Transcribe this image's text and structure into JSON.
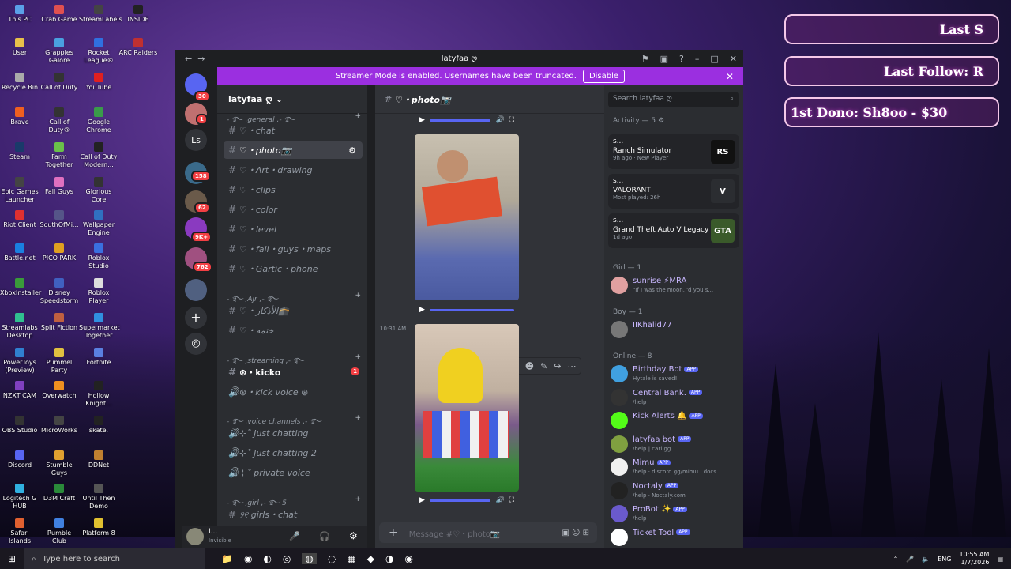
{
  "desktop": {
    "icons": [
      {
        "label": "This PC",
        "color": "#5aa0e8"
      },
      {
        "label": "Crab Game",
        "color": "#e05050"
      },
      {
        "label": "StreamLabels",
        "color": "#444"
      },
      {
        "label": "INSIDE",
        "color": "#222"
      },
      {
        "label": "User",
        "color": "#e8c04a"
      },
      {
        "label": "Grapples Galore",
        "color": "#4aa0e0"
      },
      {
        "label": "Rocket League®",
        "color": "#3070e0"
      },
      {
        "label": "ARC Raiders",
        "color": "#c03030"
      },
      {
        "label": "Recycle Bin",
        "color": "#aaa"
      },
      {
        "label": "Call of Duty",
        "color": "#333"
      },
      {
        "label": "YouTube",
        "color": "#e02020"
      },
      {
        "label": "Brave",
        "color": "#f06020"
      },
      {
        "label": "Call of Duty®",
        "color": "#333"
      },
      {
        "label": "Google Chrome",
        "color": "#3a9a4a"
      },
      {
        "label": "Steam",
        "color": "#1a3a6a"
      },
      {
        "label": "Farm Together",
        "color": "#6ac04a"
      },
      {
        "label": "Call of Duty Modern...",
        "color": "#222"
      },
      {
        "label": "Epic Games Launcher",
        "color": "#444"
      },
      {
        "label": "Fall Guys",
        "color": "#e070c0"
      },
      {
        "label": "Glorious Core",
        "color": "#333"
      },
      {
        "label": "Riot Client",
        "color": "#e03030"
      },
      {
        "label": "SouthOfMi...",
        "color": "#558"
      },
      {
        "label": "Wallpaper Engine",
        "color": "#3070c0"
      },
      {
        "label": "Battle.net",
        "color": "#1a80e0"
      },
      {
        "label": "PICO PARK",
        "color": "#e0a020"
      },
      {
        "label": "Roblox Studio",
        "color": "#3a70e0"
      },
      {
        "label": "XboxInstaller",
        "color": "#3a9a3a"
      },
      {
        "label": "Disney Speedstorm",
        "color": "#4060c0"
      },
      {
        "label": "Roblox Player",
        "color": "#ddd"
      },
      {
        "label": "Streamlabs Desktop",
        "color": "#30c090"
      },
      {
        "label": "Split Fiction",
        "color": "#c06040"
      },
      {
        "label": "Supermarket Together",
        "color": "#3090e0"
      },
      {
        "label": "PowerToys (Preview)",
        "color": "#3080d0"
      },
      {
        "label": "Pummel Party",
        "color": "#e0c040"
      },
      {
        "label": "Fortnite",
        "color": "#5a80e0"
      },
      {
        "label": "NZXT CAM",
        "color": "#8040c0"
      },
      {
        "label": "Overwatch",
        "color": "#f09020"
      },
      {
        "label": "Hollow Knight...",
        "color": "#222"
      },
      {
        "label": "OBS Studio",
        "color": "#333"
      },
      {
        "label": "MicroWorks",
        "color": "#444"
      },
      {
        "label": "skate.",
        "color": "#222"
      },
      {
        "label": "Discord",
        "color": "#5865f2"
      },
      {
        "label": "Stumble Guys",
        "color": "#e0a030"
      },
      {
        "label": "DDNet",
        "color": "#c08030"
      },
      {
        "label": "Logitech G HUB",
        "color": "#30b0e0"
      },
      {
        "label": "D3M Craft",
        "color": "#2a8a3a"
      },
      {
        "label": "Until Then Demo",
        "color": "#555"
      },
      {
        "label": "Safari Islands",
        "color": "#e06030"
      },
      {
        "label": "Rumble Club",
        "color": "#4080e0"
      },
      {
        "label": "Platform 8",
        "color": "#e0c030"
      }
    ]
  },
  "overlay": {
    "last_sub": "Last S",
    "last_follow": "Last Follow: R",
    "donation": "1st Dono: Sh8oo - $30"
  },
  "window": {
    "title": "latyfaa ღ"
  },
  "streamer": {
    "text": "Streamer Mode is enabled. Usernames have been truncated.",
    "button": "Disable"
  },
  "guilds": {
    "badges": [
      "30",
      "1",
      "158",
      "62",
      "9K+",
      "762"
    ],
    "dm_label": "Ls"
  },
  "server": {
    "name": "latyfaa ღ",
    "categories": [
      {
        "label": "- ࿐ ,general ,- ࿐"
      },
      {
        "label": "- ࿐ ,Ajr ,- ࿐"
      },
      {
        "label": "- ࿐ ,streaming ,- ࿐"
      },
      {
        "label": "- ࿐ ,voice channels ,- ࿐"
      },
      {
        "label": "- ࿐ ,girl ,- ࿐ 5"
      }
    ],
    "channels": [
      {
        "label": "♡・chat"
      },
      {
        "label": "♡・photo📷"
      },
      {
        "label": "♡・Art・drawing"
      },
      {
        "label": "♡・clips"
      },
      {
        "label": "♡・color"
      },
      {
        "label": "♡・level"
      },
      {
        "label": "♡・fall・guys・maps"
      },
      {
        "label": "♡・Gartic・phone"
      },
      {
        "label": "♡・الأذكار🕋"
      },
      {
        "label": "♡・ختمه"
      },
      {
        "label": "⊛・kicko"
      },
      {
        "label": "⊛・kick voice ⊛"
      },
      {
        "label": "⊹˚ Just chatting"
      },
      {
        "label": "⊹˚ Just chatting 2"
      },
      {
        "label": "⊹˚ private voice"
      },
      {
        "label": "୨୧ girls・chat"
      }
    ],
    "kick_badge": "1"
  },
  "user": {
    "name": "I...",
    "status": "Invisible"
  },
  "chat": {
    "channel": "♡・photo📷",
    "timestamp": "10:31 AM",
    "placeholder": "Message #♡・photo📷"
  },
  "members": {
    "search_placeholder": "Search latyfaa ღ",
    "activity_header": "Activity — 5",
    "activities": [
      {
        "user": "s...",
        "game": "Ranch Simulator",
        "meta": "9h ago · New Player",
        "icon": "RS",
        "color": "#111"
      },
      {
        "user": "s...",
        "game": "VALORANT",
        "meta": "Most played: 26h",
        "icon": "V",
        "color": "#2b2d31"
      },
      {
        "user": "s...",
        "game": "Grand Theft Auto V Legacy",
        "meta": "1d ago",
        "icon": "GTA",
        "color": "#3a5a2a"
      }
    ],
    "groups": [
      {
        "label": "Girl — 1",
        "members": [
          {
            "name": "sunrise ⚡MRA",
            "status": "\"If I was the moon, 'd you s...",
            "color": "#e0a0a0"
          }
        ]
      },
      {
        "label": "Boy — 1",
        "members": [
          {
            "name": "IIKhalid77",
            "status": "",
            "color": "#777"
          }
        ]
      },
      {
        "label": "Online — 8",
        "members": [
          {
            "name": "Birthday Bot",
            "status": "Hytale is saved!",
            "color": "#40a0e0"
          },
          {
            "name": "Central Bank.",
            "status": "/help",
            "color": "#333"
          },
          {
            "name": "Kick Alerts 🔔",
            "status": "",
            "color": "#53fc18"
          },
          {
            "name": "latyfaa bot",
            "status": "/help | carl.gg",
            "color": "#80a040"
          },
          {
            "name": "Mimu",
            "status": "/help · discord.gg/mimu · docs...",
            "color": "#f0f0f0"
          },
          {
            "name": "Noctaly",
            "status": "/help · Noctaly.com",
            "color": "#222"
          },
          {
            "name": "ProBot ✨",
            "status": "/help",
            "color": "#6a5acd"
          },
          {
            "name": "Ticket Tool",
            "status": "",
            "color": "#fff"
          }
        ]
      }
    ]
  },
  "app_badge": "APP",
  "taskbar": {
    "search": "Type here to search",
    "lang": "ENG",
    "time": "10:55 AM",
    "date": "1/7/2026"
  }
}
